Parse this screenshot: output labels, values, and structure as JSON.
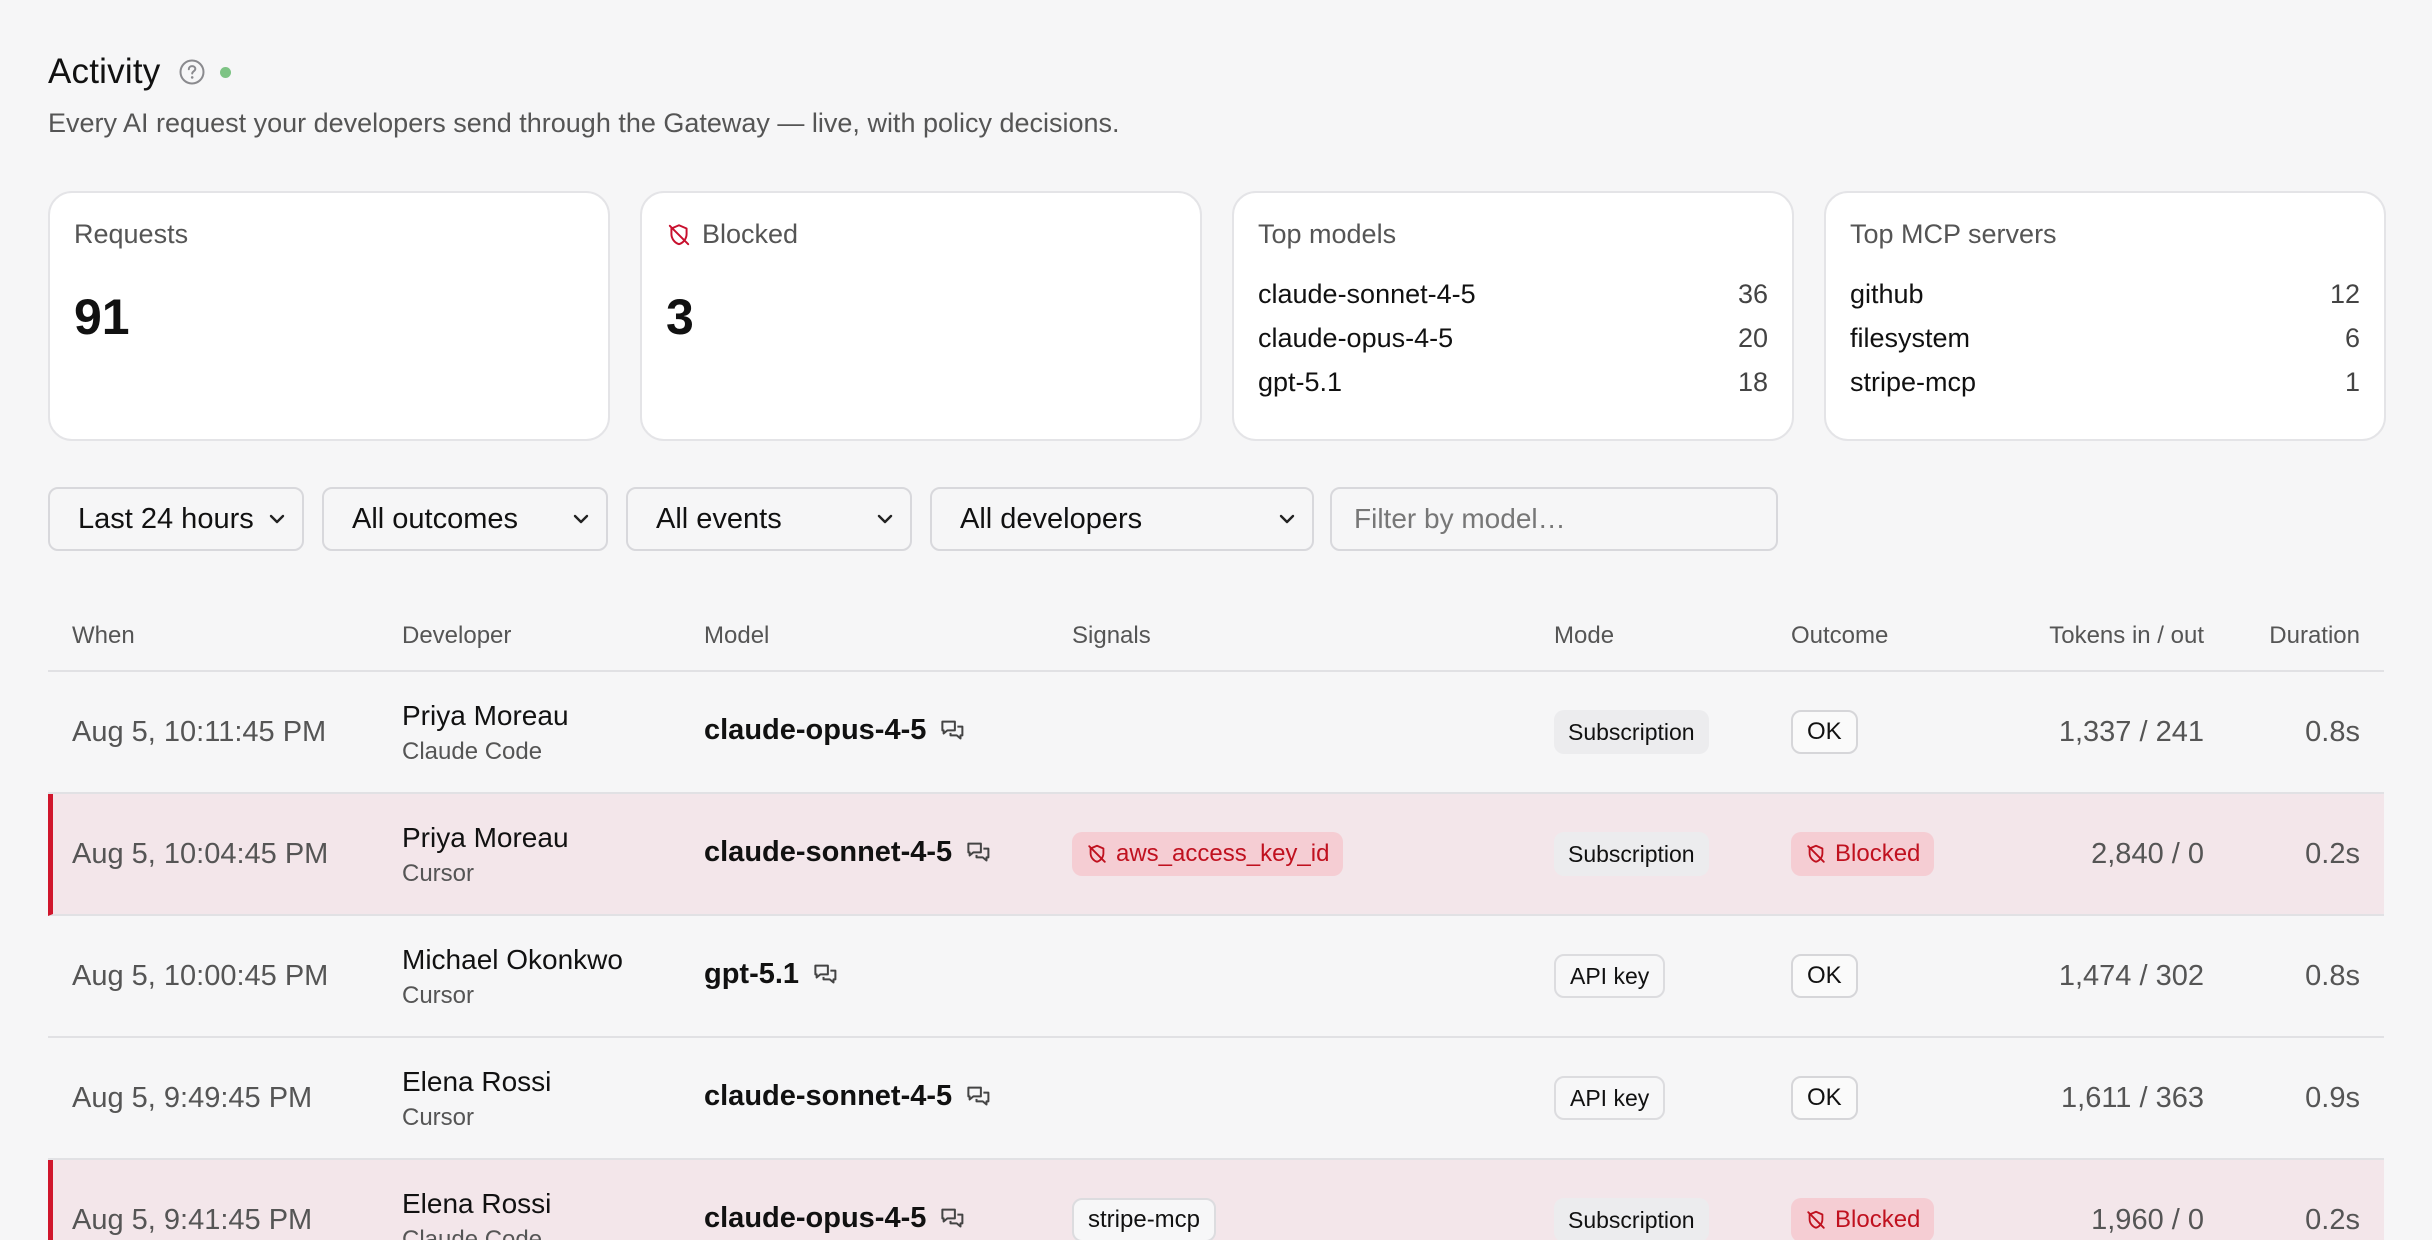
{
  "header": {
    "title": "Activity",
    "subtitle": "Every AI request your developers send through the Gateway — live, with policy decisions."
  },
  "cards": {
    "requests": {
      "label": "Requests",
      "value": "91"
    },
    "blocked": {
      "label": "Blocked",
      "value": "3"
    },
    "top_models": {
      "label": "Top models",
      "items": [
        {
          "name": "claude-sonnet-4-5",
          "count": "36"
        },
        {
          "name": "claude-opus-4-5",
          "count": "20"
        },
        {
          "name": "gpt-5.1",
          "count": "18"
        }
      ]
    },
    "top_mcp": {
      "label": "Top MCP servers",
      "items": [
        {
          "name": "github",
          "count": "12"
        },
        {
          "name": "filesystem",
          "count": "6"
        },
        {
          "name": "stripe-mcp",
          "count": "1"
        }
      ]
    }
  },
  "filters": {
    "time": "Last 24 hours",
    "outcomes": "All outcomes",
    "events": "All events",
    "developers": "All developers",
    "model_placeholder": "Filter by model…"
  },
  "table": {
    "headers": {
      "when": "When",
      "developer": "Developer",
      "model": "Model",
      "signals": "Signals",
      "mode": "Mode",
      "outcome": "Outcome",
      "tokens": "Tokens in / out",
      "duration": "Duration"
    },
    "rows": [
      {
        "when": "Aug 5, 10:11:45 PM",
        "developer": "Priya Moreau",
        "tool": "Claude Code",
        "model": "claude-opus-4-5",
        "signal": "",
        "mode": "Subscription",
        "outcome": "OK",
        "tokens": "1,337 / 241",
        "duration": "0.8s"
      },
      {
        "when": "Aug 5, 10:04:45 PM",
        "developer": "Priya Moreau",
        "tool": "Cursor",
        "model": "claude-sonnet-4-5",
        "signal": "aws_access_key_id",
        "mode": "Subscription",
        "outcome": "Blocked",
        "tokens": "2,840 / 0",
        "duration": "0.2s"
      },
      {
        "when": "Aug 5, 10:00:45 PM",
        "developer": "Michael Okonkwo",
        "tool": "Cursor",
        "model": "gpt-5.1",
        "signal": "",
        "mode": "API key",
        "outcome": "OK",
        "tokens": "1,474 / 302",
        "duration": "0.8s"
      },
      {
        "when": "Aug 5, 9:49:45 PM",
        "developer": "Elena Rossi",
        "tool": "Cursor",
        "model": "claude-sonnet-4-5",
        "signal": "",
        "mode": "API key",
        "outcome": "OK",
        "tokens": "1,611 / 363",
        "duration": "0.9s"
      },
      {
        "when": "Aug 5, 9:41:45 PM",
        "developer": "Elena Rossi",
        "tool": "Claude Code",
        "model": "claude-opus-4-5",
        "signal": "stripe-mcp",
        "mode": "Subscription",
        "outcome": "Blocked",
        "tokens": "1,960 / 0",
        "duration": "0.2s"
      }
    ]
  }
}
